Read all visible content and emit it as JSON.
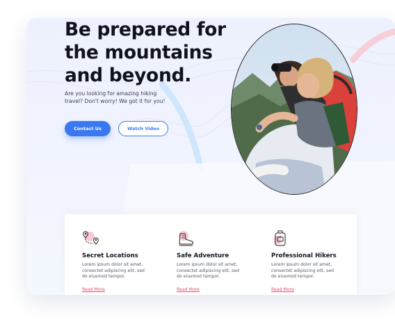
{
  "hero": {
    "headline": "Be prepared for\nthe mountains\nand beyond.",
    "subtitle": "Are you looking for amazing hiking\ntravel? Don't worry! We got it for you!",
    "primary_button": "Contact Us",
    "secondary_button": "Watch Video"
  },
  "features": [
    {
      "icon": "location-pins-icon",
      "title": "Secret Locations",
      "description": "Lorem ipsum dolor sit amet,\nconsectet adipiscing elit, sed\ndo eiusmod tempor.",
      "link": "Read More"
    },
    {
      "icon": "hiking-boot-icon",
      "title": "Safe Adventure",
      "description": "Lorem ipsum dolor sit amet,\nconsectet adipiscing elit, sed\ndo eiusmod tempor.",
      "link": "Read More"
    },
    {
      "icon": "backpack-icon",
      "title": "Professional Hikers",
      "description": "Lorem ipsum dolor sit amet,\nconsectet adipiscing elit, sed\ndo eiusmod tempor.",
      "link": "Read More"
    }
  ],
  "colors": {
    "primary": "#3a78f2",
    "accent": "#e54a6e",
    "heading": "#10121c",
    "background": "#edf1fd"
  }
}
